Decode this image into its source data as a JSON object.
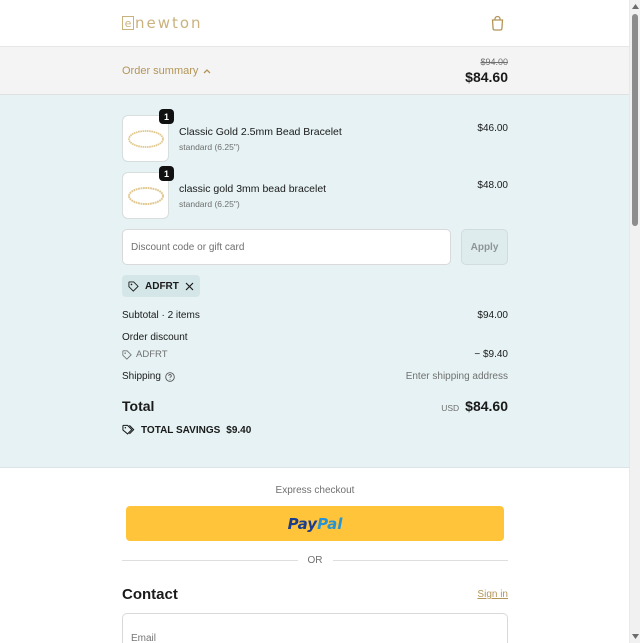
{
  "header": {
    "logo_initial": "e",
    "logo_text": "newton",
    "icons": {
      "cart": "shopping-bag-icon"
    }
  },
  "summary_toggle": {
    "label": "Order summary",
    "original_price": "$94.00",
    "total_price": "$84.60"
  },
  "items": [
    {
      "quantity": "1",
      "name": "Classic Gold 2.5mm Bead Bracelet",
      "variant": "standard (6.25\")",
      "price": "$46.00"
    },
    {
      "quantity": "1",
      "name": "classic gold 3mm bead bracelet",
      "variant": "standard (6.25\")",
      "price": "$48.00"
    }
  ],
  "discount": {
    "placeholder": "Discount code or gift card",
    "value": "",
    "apply_label": "Apply",
    "applied_code": "ADFRT"
  },
  "totals": {
    "subtotal_label": "Subtotal · 2 items",
    "subtotal_value": "$94.00",
    "order_discount_label": "Order discount",
    "discount_code": "ADFRT",
    "discount_value": "− $9.40",
    "shipping_label": "Shipping",
    "shipping_value": "Enter shipping address",
    "total_label": "Total",
    "currency": "USD",
    "total_value": "$84.60",
    "savings_label": "TOTAL SAVINGS",
    "savings_value": "$9.40"
  },
  "checkout": {
    "express_title": "Express checkout",
    "paypal_text_1": "Pay",
    "paypal_text_2": "Pal",
    "or_label": "OR",
    "contact_title": "Contact",
    "signin_label": "Sign in",
    "email_placeholder": "Email"
  },
  "colors": {
    "accent": "#b39558",
    "summary_bg": "#e6f2f3",
    "paypal_yellow": "#ffc43a"
  }
}
